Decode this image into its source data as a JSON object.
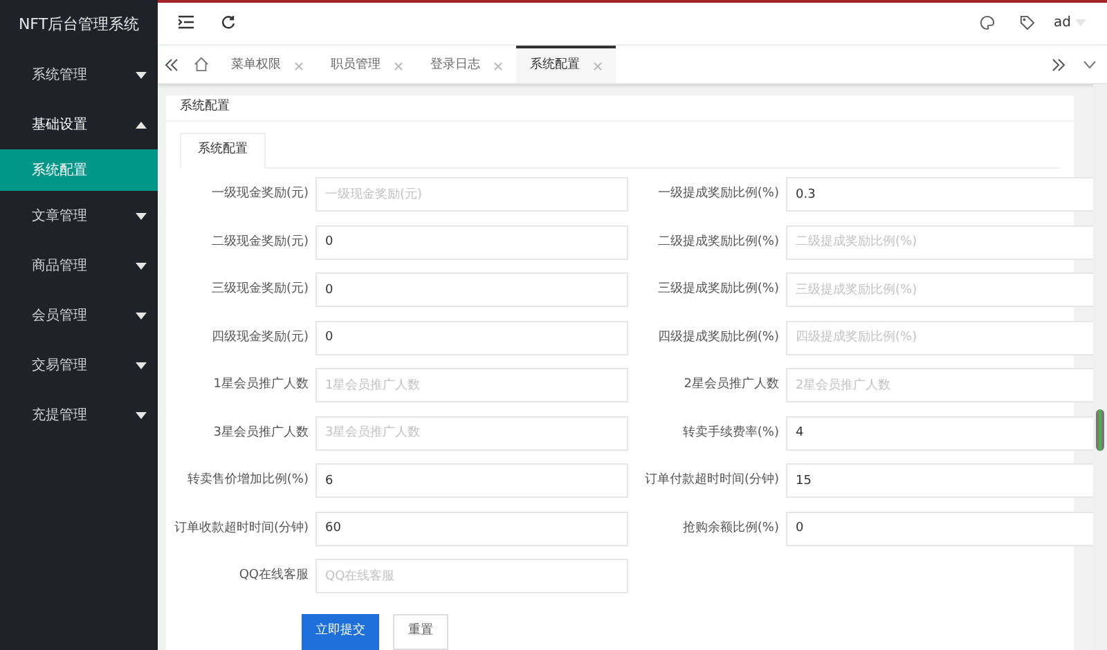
{
  "app_title": "NFT后台管理系统",
  "sidebar": {
    "items": [
      {
        "label": "系统管理",
        "expanded": false,
        "selected": false
      },
      {
        "label": "基础设置",
        "expanded": true,
        "selected": false,
        "children": [
          {
            "label": "系统配置",
            "selected": true
          }
        ]
      },
      {
        "label": "文章管理",
        "expanded": false,
        "selected": false
      },
      {
        "label": "商品管理",
        "expanded": false,
        "selected": false
      },
      {
        "label": "会员管理",
        "expanded": false,
        "selected": false
      },
      {
        "label": "交易管理",
        "expanded": false,
        "selected": false
      },
      {
        "label": "充提管理",
        "expanded": false,
        "selected": false
      }
    ]
  },
  "header": {
    "user": "ad"
  },
  "tabs": [
    {
      "label": "菜单权限",
      "selected": false
    },
    {
      "label": "职员管理",
      "selected": false
    },
    {
      "label": "登录日志",
      "selected": false
    },
    {
      "label": "系统配置",
      "selected": true
    }
  ],
  "card": {
    "title": "系统配置",
    "inner_tabs": [
      {
        "label": "系统配置",
        "selected": true
      }
    ]
  },
  "fields": [
    {
      "label": "一级现金奖励(元)",
      "placeholder": "一级现金奖励(元)"
    },
    {
      "label": "一级提成奖励比例(%)",
      "value": "0.3"
    },
    {
      "label": "二级现金奖励(元)",
      "value": "0"
    },
    {
      "label": "二级提成奖励比例(%)",
      "placeholder": "二级提成奖励比例(%)"
    },
    {
      "label": "三级现金奖励(元)",
      "value": "0"
    },
    {
      "label": "三级提成奖励比例(%)",
      "placeholder": "三级提成奖励比例(%)"
    },
    {
      "label": "四级现金奖励(元)",
      "value": "0"
    },
    {
      "label": "四级提成奖励比例(%)",
      "placeholder": "四级提成奖励比例(%)"
    },
    {
      "label": "1星会员推广人数",
      "placeholder": "1星会员推广人数"
    },
    {
      "label": "2星会员推广人数",
      "placeholder": "2星会员推广人数"
    },
    {
      "label": "3星会员推广人数",
      "placeholder": "3星会员推广人数"
    },
    {
      "label": "转卖手续费率(%)",
      "value": "4"
    },
    {
      "label": "转卖售价增加比例(%)",
      "value": "6"
    },
    {
      "label": "订单付款超时时间(分钟)",
      "value": "15"
    },
    {
      "label": "订单收款超时时间(分钟)",
      "value": "60"
    },
    {
      "label": "抢购余额比例(%)",
      "value": "0"
    },
    {
      "label": "QQ在线客服",
      "placeholder": "QQ在线客服"
    }
  ],
  "buttons": [
    {
      "label": "立即提交",
      "kind": "primary"
    },
    {
      "label": "重置",
      "kind": "default"
    }
  ]
}
